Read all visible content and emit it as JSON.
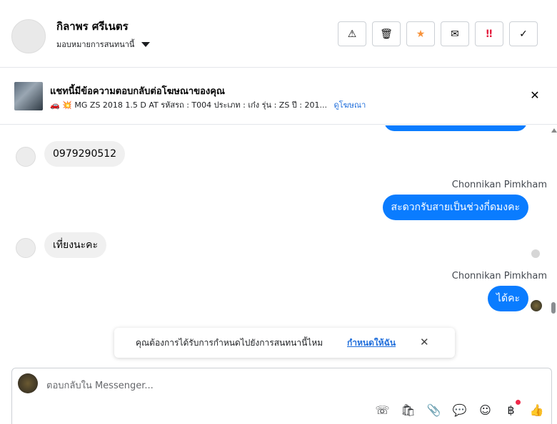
{
  "header": {
    "contact_name": "กิลาพร ศรีเนตร",
    "assign_label": "มอบหมายการสนทนานี้",
    "actions": [
      {
        "name": "report",
        "icon": "warning-icon",
        "glyph": "⚠"
      },
      {
        "name": "delete",
        "icon": "trash-icon",
        "glyph": "🗑"
      },
      {
        "name": "star",
        "icon": "star-icon",
        "glyph": "★"
      },
      {
        "name": "mark-unread",
        "icon": "envelope-icon",
        "glyph": "✉"
      },
      {
        "name": "follow-up",
        "icon": "exclamation-icon",
        "glyph": "‼"
      },
      {
        "name": "done",
        "icon": "check-icon",
        "glyph": "✓"
      }
    ]
  },
  "ad_banner": {
    "title": "แชทนี้มีข้อความตอบกลับต่อโฆษณาของคุณ",
    "emoji": "🚗 💥",
    "description": "MG ZS 2018 1.5 D AT รหัสรถ : T004 ประเภท : เก๋ง รุ่น : ZS ปี : 201...",
    "link_label": "ดูโฆษณา",
    "close_glyph": "✕"
  },
  "messages": [
    {
      "direction": "in",
      "text": "0979290512"
    },
    {
      "direction": "out",
      "sender": "Chonnikan Pimkham",
      "text": "สะดวกรับสายเป็นช่วงกี่ดมงคะ"
    },
    {
      "direction": "in",
      "text": "เที่ยงนะคะ"
    },
    {
      "direction": "out",
      "sender": "Chonnikan Pimkham",
      "text": "ได้คะ"
    }
  ],
  "toast": {
    "text": "คุณต้องการได้รับการกำหนดไปยังการสนทนานี้ไหม",
    "link_label": "กำหนดให้ฉัน",
    "close_glyph": "✕"
  },
  "composer": {
    "placeholder": "ตอบกลับใน Messenger...",
    "tools": [
      {
        "name": "call-plus",
        "icon": "phone-plus-icon",
        "glyph": "☏"
      },
      {
        "name": "shopping",
        "icon": "shopping-bag-icon",
        "glyph": "🛍"
      },
      {
        "name": "attach",
        "icon": "paperclip-icon",
        "glyph": "📎"
      },
      {
        "name": "saved-replies",
        "icon": "chat-bubble-icon",
        "glyph": "💬"
      },
      {
        "name": "emoji",
        "icon": "smiley-icon",
        "glyph": "☺"
      },
      {
        "name": "payment",
        "icon": "baht-icon",
        "glyph": "฿"
      },
      {
        "name": "like",
        "icon": "thumbs-up-icon",
        "glyph": "👍"
      }
    ]
  },
  "colors": {
    "accent": "#0a7cff",
    "link": "#216fdb",
    "star": "#f7923a",
    "follow_up": "#e41e3f",
    "badge": "#f02849"
  }
}
